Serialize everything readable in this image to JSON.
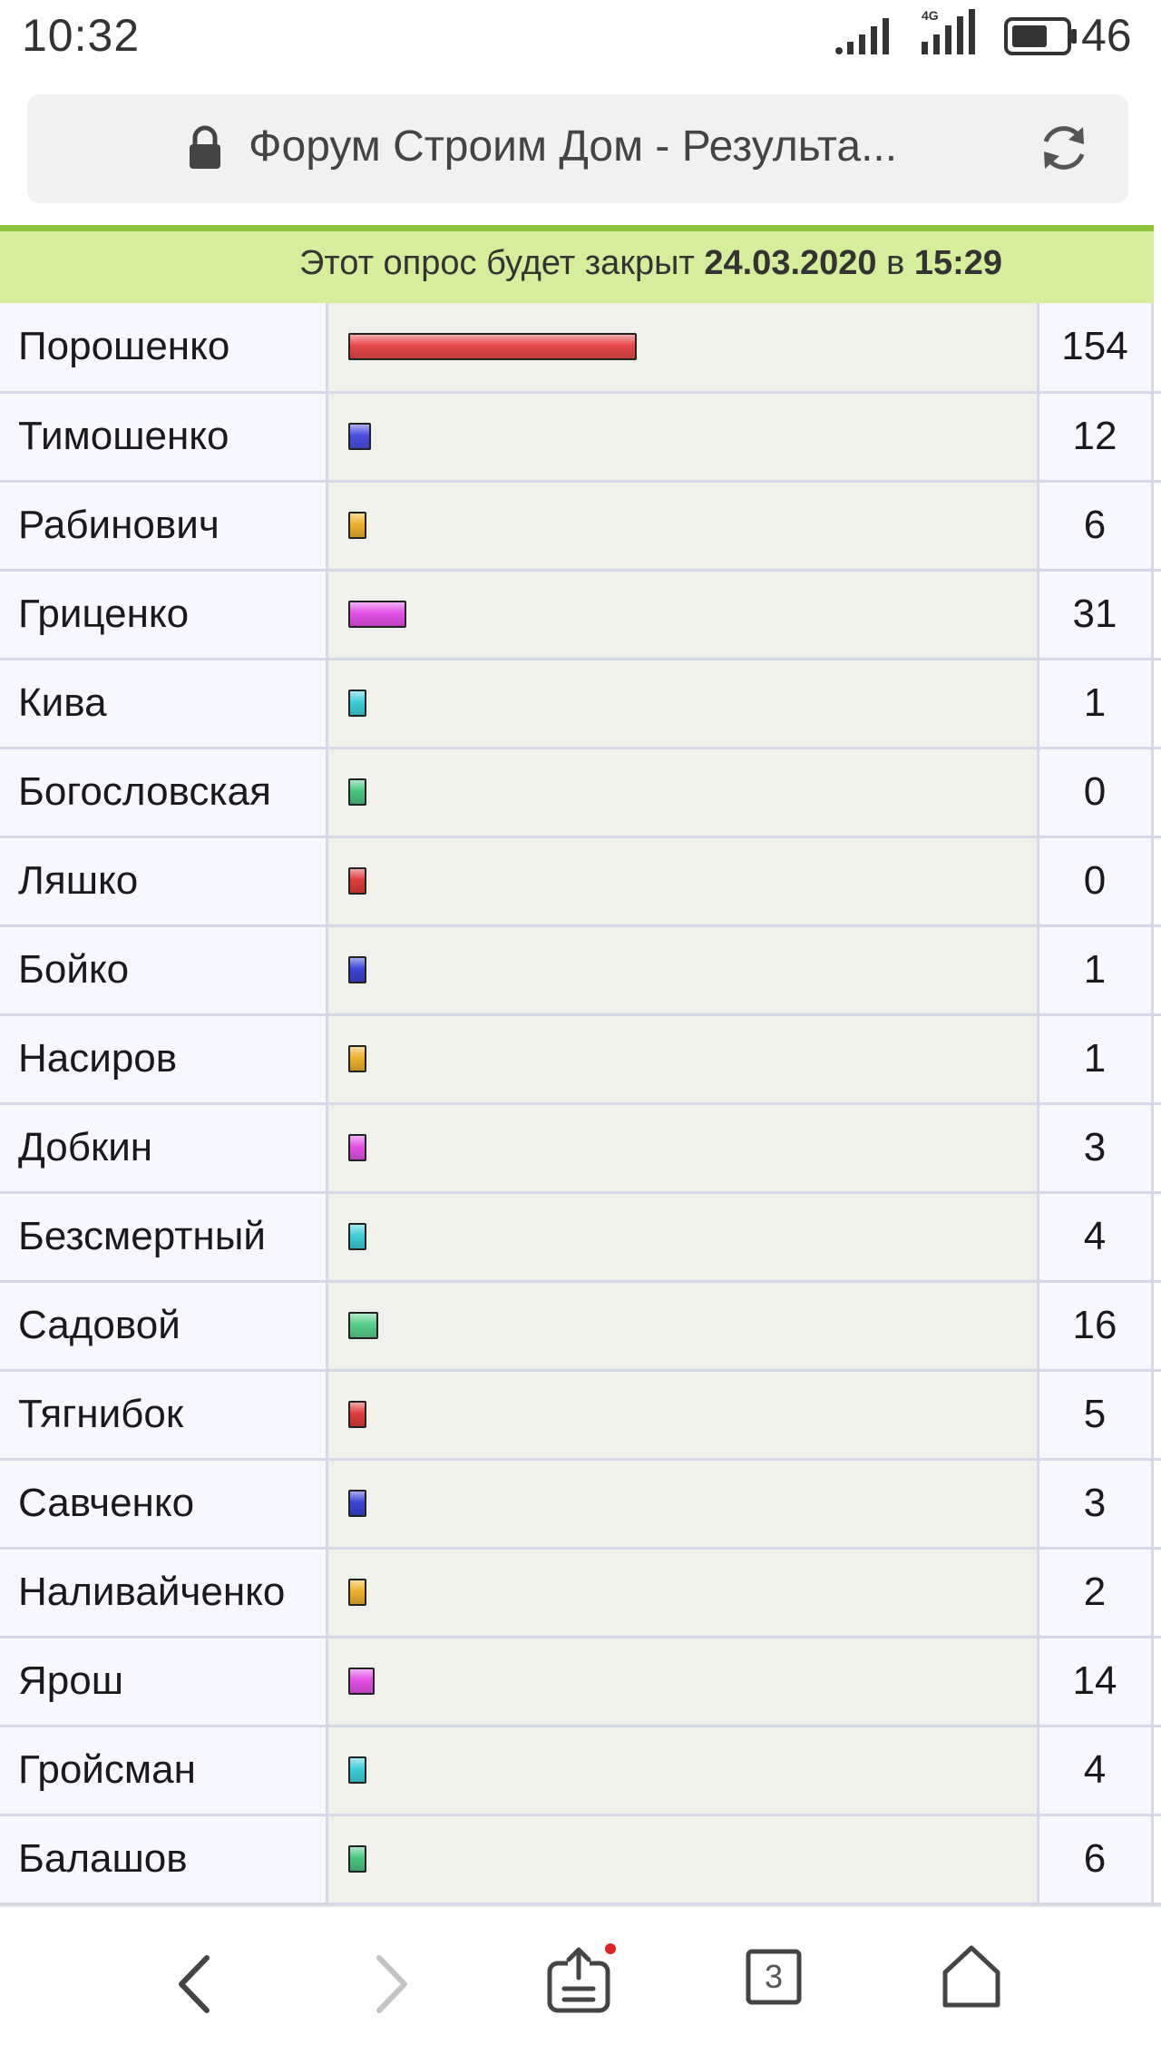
{
  "status_bar": {
    "time": "10:32",
    "network_label": "4G",
    "battery_level": "46",
    "icons": [
      "signal-icon",
      "signal-4g-icon",
      "battery-icon"
    ]
  },
  "address_bar": {
    "title": "Форум Строим Дом - Результа...",
    "icons": [
      "lock-icon",
      "reload-icon"
    ]
  },
  "poll": {
    "notice_prefix": "Этот опрос будет закрыт",
    "close_date": "24.03.2020",
    "notice_middle": "в",
    "close_time": "15:29"
  },
  "results": [
    {
      "name": "Порошенко",
      "votes": "154",
      "value": 154,
      "color": "#e8484a"
    },
    {
      "name": "Тимошенко",
      "votes": "12",
      "value": 12,
      "color": "#4a4ee0"
    },
    {
      "name": "Рабинович",
      "votes": "6",
      "value": 6,
      "color": "#f0b02c"
    },
    {
      "name": "Гриценко",
      "votes": "31",
      "value": 31,
      "color": "#e450e8"
    },
    {
      "name": "Кива",
      "votes": "1",
      "value": 1,
      "color": "#3ccfd8"
    },
    {
      "name": "Богословская",
      "votes": "0",
      "value": 0,
      "color": "#48c880"
    },
    {
      "name": "Ляшко",
      "votes": "0",
      "value": 0,
      "color": "#e03c3c"
    },
    {
      "name": "Бойко",
      "votes": "1",
      "value": 1,
      "color": "#3c44d8"
    },
    {
      "name": "Насиров",
      "votes": "1",
      "value": 1,
      "color": "#f0b02c"
    },
    {
      "name": "Добкин",
      "votes": "3",
      "value": 3,
      "color": "#e450e8"
    },
    {
      "name": "Безсмертный",
      "votes": "4",
      "value": 4,
      "color": "#3ccfd8"
    },
    {
      "name": "Садовой",
      "votes": "16",
      "value": 16,
      "color": "#56cf8a"
    },
    {
      "name": "Тягнибок",
      "votes": "5",
      "value": 5,
      "color": "#e03c3c"
    },
    {
      "name": "Савченко",
      "votes": "3",
      "value": 3,
      "color": "#3c44d8"
    },
    {
      "name": "Наливайченко",
      "votes": "2",
      "value": 2,
      "color": "#f0b02c"
    },
    {
      "name": "Ярош",
      "votes": "14",
      "value": 14,
      "color": "#e450e8"
    },
    {
      "name": "Гройсман",
      "votes": "4",
      "value": 4,
      "color": "#3ccfd8"
    },
    {
      "name": "Балашов",
      "votes": "6",
      "value": 6,
      "color": "#48c880"
    }
  ],
  "bottom_nav": {
    "tab_count": "3",
    "icons": [
      "back-arrow-icon",
      "forward-arrow-icon",
      "share-icon",
      "tabs-icon",
      "home-icon"
    ],
    "share_badge_color": "#e02424"
  }
}
